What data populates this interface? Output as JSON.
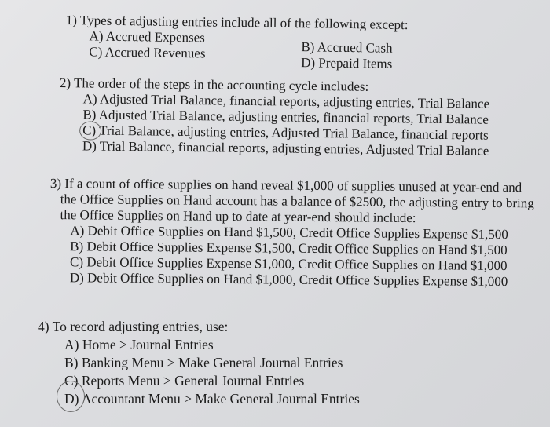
{
  "questions": [
    {
      "number": "1)",
      "stem": "Types of adjusting entries include all of the following except:",
      "options": [
        {
          "label": "A)",
          "text": "Accrued Expenses"
        },
        {
          "label": "B)",
          "text": "Accrued Cash"
        },
        {
          "label": "C)",
          "text": "Accrued Revenues"
        },
        {
          "label": "D)",
          "text": "Prepaid Items"
        }
      ]
    },
    {
      "number": "2)",
      "stem": "The order of the steps in the accounting cycle includes:",
      "options": [
        {
          "label": "A)",
          "text": "Adjusted Trial Balance, financial reports, adjusting entries, Trial Balance"
        },
        {
          "label": "B)",
          "text": "Adjusted Trial Balance, adjusting entries, financial reports, Trial Balance"
        },
        {
          "label": "C)",
          "text": "Trial Balance, adjusting entries, Adjusted Trial Balance, financial reports",
          "circled": true
        },
        {
          "label": "D)",
          "text": "Trial Balance, financial reports, adjusting entries, Adjusted Trial Balance"
        }
      ]
    },
    {
      "number": "3)",
      "stem_lines": [
        "If a count of office supplies on hand reveal $1,000 of supplies unused at year-end and",
        "the Office Supplies on Hand account has a balance of $2500, the adjusting entry to bring",
        "the Office Supplies on Hand up to date at year-end should include:"
      ],
      "options": [
        {
          "label": "A)",
          "text": "Debit Office Supplies on Hand $1,500, Credit Office Supplies Expense $1,500"
        },
        {
          "label": "B)",
          "text": "Debit Office Supplies Expense $1,500, Credit Office Supplies on Hand $1,500"
        },
        {
          "label": "C)",
          "text": "Debit Office Supplies Expense $1,000, Credit Office Supplies on Hand $1,000"
        },
        {
          "label": "D)",
          "text": "Debit Office Supplies on Hand $1,000, Credit Office Supplies Expense $1,000"
        }
      ]
    },
    {
      "number": "4)",
      "stem": "To record adjusting entries, use:",
      "options": [
        {
          "label": "A)",
          "text": "Home > Journal Entries"
        },
        {
          "label": "B)",
          "text": "Banking Menu > Make General Journal Entries"
        },
        {
          "label": "C)",
          "text": "Reports Menu > General Journal Entries"
        },
        {
          "label": "D)",
          "text": "Accountant Menu > Make General Journal Entries",
          "circled": true
        }
      ]
    }
  ]
}
